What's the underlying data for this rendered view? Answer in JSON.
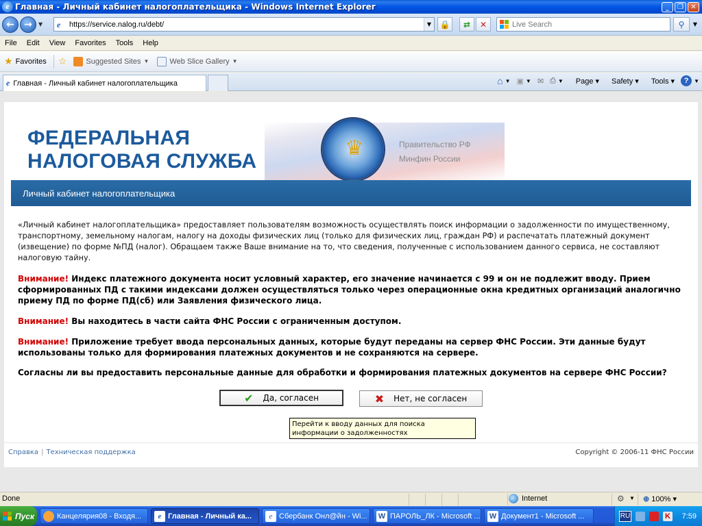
{
  "window": {
    "title": "Главная - Личный кабинет налогоплательщика - Windows Internet Explorer"
  },
  "nav": {
    "url": "https://service.nalog.ru/debt/",
    "search_placeholder": "Live Search"
  },
  "menu": [
    "File",
    "Edit",
    "View",
    "Favorites",
    "Tools",
    "Help"
  ],
  "favorites_bar": {
    "favorites_label": "Favorites",
    "suggested_sites": "Suggested Sites",
    "web_slice_gallery": "Web Slice Gallery"
  },
  "tab": {
    "label": "Главная - Личный кабинет налогоплательщика"
  },
  "command_bar": {
    "page": "Page",
    "safety": "Safety",
    "tools": "Tools"
  },
  "site": {
    "title_line1": "ФЕДЕРАЛЬНАЯ",
    "title_line2": "НАЛОГОВАЯ СЛУЖБА",
    "gov_line1": "Правительство РФ",
    "gov_line2": "Минфин России",
    "section_title": "Личный кабинет налогоплательщика",
    "intro": "«Личный кабинет налогоплательщика» предоставляет пользователям возможность осуществлять поиск информации о задолженности по имущественному, транспортному, земельному налогам, налогу на доходы физических лиц (только для физических лиц, граждан РФ) и распечатать платежный документ (извещение) по форме №ПД (налог). Обращаем также Ваше внимание на то, что сведения, полученные с использованием данного сервиса, не составляют налоговую тайну.",
    "warning_label": "Внимание!",
    "warning1": " Индекс платежного документа носит условный характер, его значение начинается с 99 и он не подлежит вводу. Прием сформированных ПД с такими индексами должен осуществляться только через операционные окна кредитных организаций аналогично приему ПД по форме ПД(сб) или Заявления физического лица.",
    "warning2": " Вы находитесь в части сайта ФНС России с ограниченным доступом.",
    "warning3": " Приложение требует ввода персональных данных, которые будут переданы на сервер ФНС России. Эти данные будут использованы только для формирования платежных документов и не сохраняются на сервере.",
    "question": "Согласны ли вы предоставить персональные данные для обработки и формирования платежных документов на сервере ФНС России?",
    "agree_button": "Да, согласен",
    "disagree_button": "Нет, не согласен",
    "tooltip": "Перейти к вводу данных для поиска информации о задолженностях",
    "footer_help": "Справка",
    "footer_support": "Техническая поддержка",
    "copyright": "Copyright © 2006-11 ФНС России"
  },
  "statusbar": {
    "status": "Done",
    "zone": "Internet",
    "zoom": "100%"
  },
  "taskbar": {
    "start": "Пуск",
    "tasks": [
      "Канцелярия08 - Входя...",
      "Главная - Личный ка...",
      "Сбербанк Онл@йн - Wi...",
      "ПАРОЛЬ_ЛК - Microsoft ...",
      "Документ1 - Microsoft ..."
    ],
    "lang": "RU",
    "clock": "7:59"
  },
  "colors": {
    "brand_blue": "#1c5a9c",
    "strip_blue": "#245f9a",
    "warning_red": "#d20000"
  }
}
